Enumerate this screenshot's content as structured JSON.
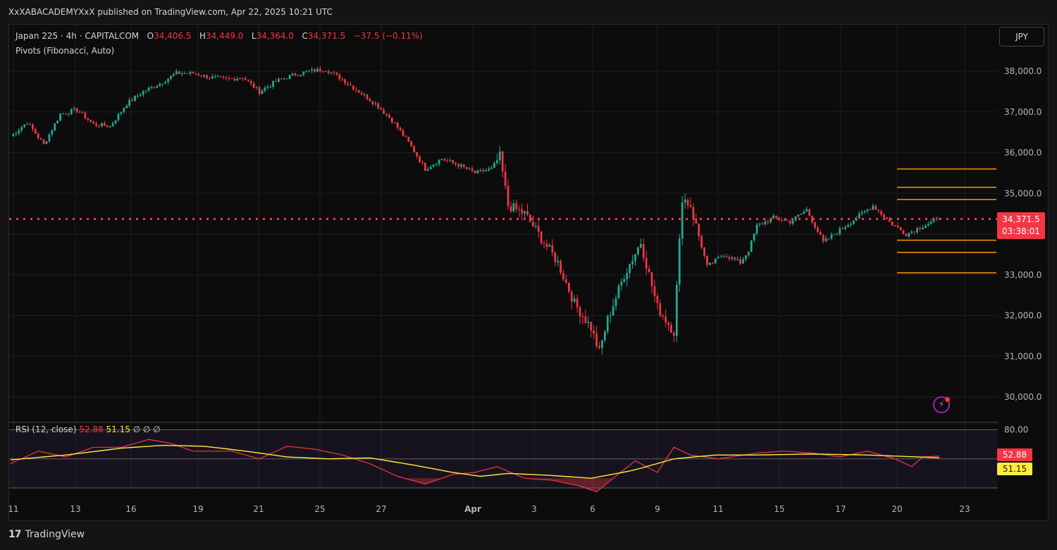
{
  "header": {
    "published": "XxXABACADEMYXxX published on TradingView.com, Apr 22, 2025 10:21 UTC"
  },
  "legend": {
    "symbol": "Japan 225 · 4h · CAPITALCOM",
    "open_label": "O",
    "open": "34,406.5",
    "high_label": "H",
    "high": "34,449.0",
    "low_label": "L",
    "low": "34,364.0",
    "close_label": "C",
    "close": "34,371.5",
    "change": "−37.5 (−0.11%)",
    "pivots": "Pivots (Fibonacci, Auto)"
  },
  "currency_button": "JPY",
  "last_price_tag": {
    "price": "34,371.5",
    "countdown": "03:38:01"
  },
  "rsi_legend": {
    "label": "RSI (12, close)",
    "rsi": "52.88",
    "ma": "51.15",
    "extra": "∅ ∅ ∅"
  },
  "rsi_tags": {
    "rsi": "52.88",
    "ma": "51.15"
  },
  "footer": {
    "brand": "TradingView"
  },
  "icons": {
    "flash": "lightning-icon",
    "logo": "tradingview-logo-icon"
  },
  "colors": {
    "up": "#22ab94",
    "down": "#f23645",
    "pivot": "#ff9800",
    "rsi_line": "#f23645",
    "rsi_ma": "#ffeb3b",
    "grid": "#1e1e1e"
  },
  "chart_data": {
    "type": "candlestick",
    "symbol": "Japan 225",
    "interval": "4h",
    "y_ticks": [
      "38,000.0",
      "37,000.0",
      "36,000.0",
      "35,000.0",
      "34,000.0",
      "33,000.0",
      "32,000.0",
      "31,000.0",
      "30,000.0"
    ],
    "y_range": [
      29750,
      38600
    ],
    "x_ticks": [
      "11",
      "13",
      "16",
      "19",
      "21",
      "25",
      "27",
      "Apr",
      "3",
      "6",
      "9",
      "11",
      "15",
      "17",
      "20",
      "23"
    ],
    "last_close": 34371.5,
    "price_path": [
      [
        0,
        36400
      ],
      [
        6,
        36750
      ],
      [
        12,
        36200
      ],
      [
        18,
        36950
      ],
      [
        24,
        37050
      ],
      [
        30,
        36700
      ],
      [
        36,
        36650
      ],
      [
        42,
        37200
      ],
      [
        48,
        37500
      ],
      [
        54,
        37700
      ],
      [
        60,
        37950
      ],
      [
        66,
        37950
      ],
      [
        72,
        37850
      ],
      [
        78,
        37800
      ],
      [
        84,
        37850
      ],
      [
        90,
        37500
      ],
      [
        96,
        37750
      ],
      [
        102,
        37900
      ],
      [
        108,
        38000
      ],
      [
        114,
        38050
      ],
      [
        120,
        37800
      ],
      [
        126,
        37500
      ],
      [
        132,
        37200
      ],
      [
        138,
        36800
      ],
      [
        144,
        36250
      ],
      [
        150,
        35600
      ],
      [
        156,
        35850
      ],
      [
        162,
        35700
      ],
      [
        168,
        35500
      ],
      [
        174,
        35600
      ],
      [
        177,
        35900
      ],
      [
        180,
        34700
      ],
      [
        186,
        34500
      ],
      [
        192,
        33900
      ],
      [
        198,
        33300
      ],
      [
        204,
        32300
      ],
      [
        210,
        31700
      ],
      [
        213,
        31100
      ],
      [
        216,
        31900
      ],
      [
        222,
        33000
      ],
      [
        228,
        33800
      ],
      [
        234,
        32200
      ],
      [
        237,
        31900
      ],
      [
        240,
        31600
      ],
      [
        243,
        34900
      ],
      [
        246,
        34700
      ],
      [
        252,
        33200
      ],
      [
        258,
        33500
      ],
      [
        264,
        33300
      ],
      [
        267,
        33600
      ],
      [
        270,
        34200
      ],
      [
        276,
        34400
      ],
      [
        282,
        34300
      ],
      [
        288,
        34600
      ],
      [
        294,
        33800
      ],
      [
        300,
        34100
      ],
      [
        306,
        34400
      ],
      [
        312,
        34700
      ],
      [
        318,
        34300
      ],
      [
        324,
        34000
      ],
      [
        330,
        34200
      ],
      [
        336,
        34371.5
      ]
    ],
    "pivot_levels": [
      35600,
      35150,
      34850,
      33850,
      33550,
      33050
    ],
    "rsi": {
      "length": 12,
      "levels": [
        80,
        50,
        20
      ],
      "last_rsi": 52.88,
      "last_ma": 51.15,
      "ma_path": [
        [
          0,
          49
        ],
        [
          20,
          54
        ],
        [
          40,
          61
        ],
        [
          55,
          64
        ],
        [
          70,
          63
        ],
        [
          85,
          58
        ],
        [
          100,
          52
        ],
        [
          115,
          50
        ],
        [
          130,
          51
        ],
        [
          145,
          44
        ],
        [
          160,
          36
        ],
        [
          170,
          32
        ],
        [
          180,
          35
        ],
        [
          195,
          33
        ],
        [
          210,
          30
        ],
        [
          225,
          38
        ],
        [
          240,
          50
        ],
        [
          255,
          54
        ],
        [
          270,
          54
        ],
        [
          290,
          55
        ],
        [
          310,
          54
        ],
        [
          336,
          51.15
        ]
      ],
      "rsi_path": [
        [
          0,
          45
        ],
        [
          10,
          58
        ],
        [
          20,
          52
        ],
        [
          30,
          62
        ],
        [
          40,
          62
        ],
        [
          50,
          70
        ],
        [
          58,
          66
        ],
        [
          66,
          58
        ],
        [
          74,
          58
        ],
        [
          80,
          58
        ],
        [
          90,
          50
        ],
        [
          100,
          63
        ],
        [
          110,
          60
        ],
        [
          120,
          54
        ],
        [
          130,
          45
        ],
        [
          140,
          32
        ],
        [
          150,
          24
        ],
        [
          160,
          34
        ],
        [
          168,
          36
        ],
        [
          176,
          42
        ],
        [
          186,
          30
        ],
        [
          196,
          28
        ],
        [
          206,
          22
        ],
        [
          212,
          16
        ],
        [
          218,
          30
        ],
        [
          226,
          48
        ],
        [
          234,
          36
        ],
        [
          240,
          62
        ],
        [
          246,
          54
        ],
        [
          256,
          50
        ],
        [
          270,
          56
        ],
        [
          280,
          58
        ],
        [
          290,
          56
        ],
        [
          300,
          52
        ],
        [
          310,
          58
        ],
        [
          320,
          50
        ],
        [
          326,
          42
        ],
        [
          330,
          52
        ],
        [
          336,
          52.88
        ]
      ]
    }
  }
}
